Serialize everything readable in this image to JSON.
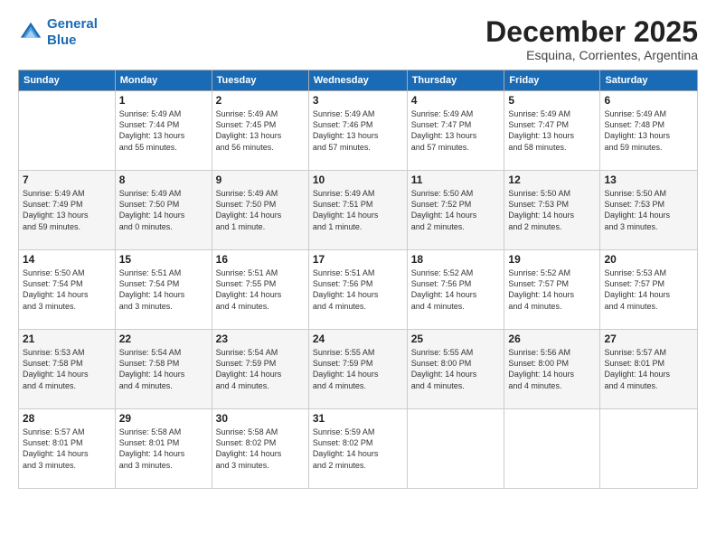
{
  "logo": {
    "line1": "General",
    "line2": "Blue"
  },
  "title": "December 2025",
  "subtitle": "Esquina, Corrientes, Argentina",
  "days_of_week": [
    "Sunday",
    "Monday",
    "Tuesday",
    "Wednesday",
    "Thursday",
    "Friday",
    "Saturday"
  ],
  "weeks": [
    [
      {
        "num": "",
        "info": ""
      },
      {
        "num": "1",
        "info": "Sunrise: 5:49 AM\nSunset: 7:44 PM\nDaylight: 13 hours\nand 55 minutes."
      },
      {
        "num": "2",
        "info": "Sunrise: 5:49 AM\nSunset: 7:45 PM\nDaylight: 13 hours\nand 56 minutes."
      },
      {
        "num": "3",
        "info": "Sunrise: 5:49 AM\nSunset: 7:46 PM\nDaylight: 13 hours\nand 57 minutes."
      },
      {
        "num": "4",
        "info": "Sunrise: 5:49 AM\nSunset: 7:47 PM\nDaylight: 13 hours\nand 57 minutes."
      },
      {
        "num": "5",
        "info": "Sunrise: 5:49 AM\nSunset: 7:47 PM\nDaylight: 13 hours\nand 58 minutes."
      },
      {
        "num": "6",
        "info": "Sunrise: 5:49 AM\nSunset: 7:48 PM\nDaylight: 13 hours\nand 59 minutes."
      }
    ],
    [
      {
        "num": "7",
        "info": "Sunrise: 5:49 AM\nSunset: 7:49 PM\nDaylight: 13 hours\nand 59 minutes."
      },
      {
        "num": "8",
        "info": "Sunrise: 5:49 AM\nSunset: 7:50 PM\nDaylight: 14 hours\nand 0 minutes."
      },
      {
        "num": "9",
        "info": "Sunrise: 5:49 AM\nSunset: 7:50 PM\nDaylight: 14 hours\nand 1 minute."
      },
      {
        "num": "10",
        "info": "Sunrise: 5:49 AM\nSunset: 7:51 PM\nDaylight: 14 hours\nand 1 minute."
      },
      {
        "num": "11",
        "info": "Sunrise: 5:50 AM\nSunset: 7:52 PM\nDaylight: 14 hours\nand 2 minutes."
      },
      {
        "num": "12",
        "info": "Sunrise: 5:50 AM\nSunset: 7:53 PM\nDaylight: 14 hours\nand 2 minutes."
      },
      {
        "num": "13",
        "info": "Sunrise: 5:50 AM\nSunset: 7:53 PM\nDaylight: 14 hours\nand 3 minutes."
      }
    ],
    [
      {
        "num": "14",
        "info": "Sunrise: 5:50 AM\nSunset: 7:54 PM\nDaylight: 14 hours\nand 3 minutes."
      },
      {
        "num": "15",
        "info": "Sunrise: 5:51 AM\nSunset: 7:54 PM\nDaylight: 14 hours\nand 3 minutes."
      },
      {
        "num": "16",
        "info": "Sunrise: 5:51 AM\nSunset: 7:55 PM\nDaylight: 14 hours\nand 4 minutes."
      },
      {
        "num": "17",
        "info": "Sunrise: 5:51 AM\nSunset: 7:56 PM\nDaylight: 14 hours\nand 4 minutes."
      },
      {
        "num": "18",
        "info": "Sunrise: 5:52 AM\nSunset: 7:56 PM\nDaylight: 14 hours\nand 4 minutes."
      },
      {
        "num": "19",
        "info": "Sunrise: 5:52 AM\nSunset: 7:57 PM\nDaylight: 14 hours\nand 4 minutes."
      },
      {
        "num": "20",
        "info": "Sunrise: 5:53 AM\nSunset: 7:57 PM\nDaylight: 14 hours\nand 4 minutes."
      }
    ],
    [
      {
        "num": "21",
        "info": "Sunrise: 5:53 AM\nSunset: 7:58 PM\nDaylight: 14 hours\nand 4 minutes."
      },
      {
        "num": "22",
        "info": "Sunrise: 5:54 AM\nSunset: 7:58 PM\nDaylight: 14 hours\nand 4 minutes."
      },
      {
        "num": "23",
        "info": "Sunrise: 5:54 AM\nSunset: 7:59 PM\nDaylight: 14 hours\nand 4 minutes."
      },
      {
        "num": "24",
        "info": "Sunrise: 5:55 AM\nSunset: 7:59 PM\nDaylight: 14 hours\nand 4 minutes."
      },
      {
        "num": "25",
        "info": "Sunrise: 5:55 AM\nSunset: 8:00 PM\nDaylight: 14 hours\nand 4 minutes."
      },
      {
        "num": "26",
        "info": "Sunrise: 5:56 AM\nSunset: 8:00 PM\nDaylight: 14 hours\nand 4 minutes."
      },
      {
        "num": "27",
        "info": "Sunrise: 5:57 AM\nSunset: 8:01 PM\nDaylight: 14 hours\nand 4 minutes."
      }
    ],
    [
      {
        "num": "28",
        "info": "Sunrise: 5:57 AM\nSunset: 8:01 PM\nDaylight: 14 hours\nand 3 minutes."
      },
      {
        "num": "29",
        "info": "Sunrise: 5:58 AM\nSunset: 8:01 PM\nDaylight: 14 hours\nand 3 minutes."
      },
      {
        "num": "30",
        "info": "Sunrise: 5:58 AM\nSunset: 8:02 PM\nDaylight: 14 hours\nand 3 minutes."
      },
      {
        "num": "31",
        "info": "Sunrise: 5:59 AM\nSunset: 8:02 PM\nDaylight: 14 hours\nand 2 minutes."
      },
      {
        "num": "",
        "info": ""
      },
      {
        "num": "",
        "info": ""
      },
      {
        "num": "",
        "info": ""
      }
    ]
  ]
}
